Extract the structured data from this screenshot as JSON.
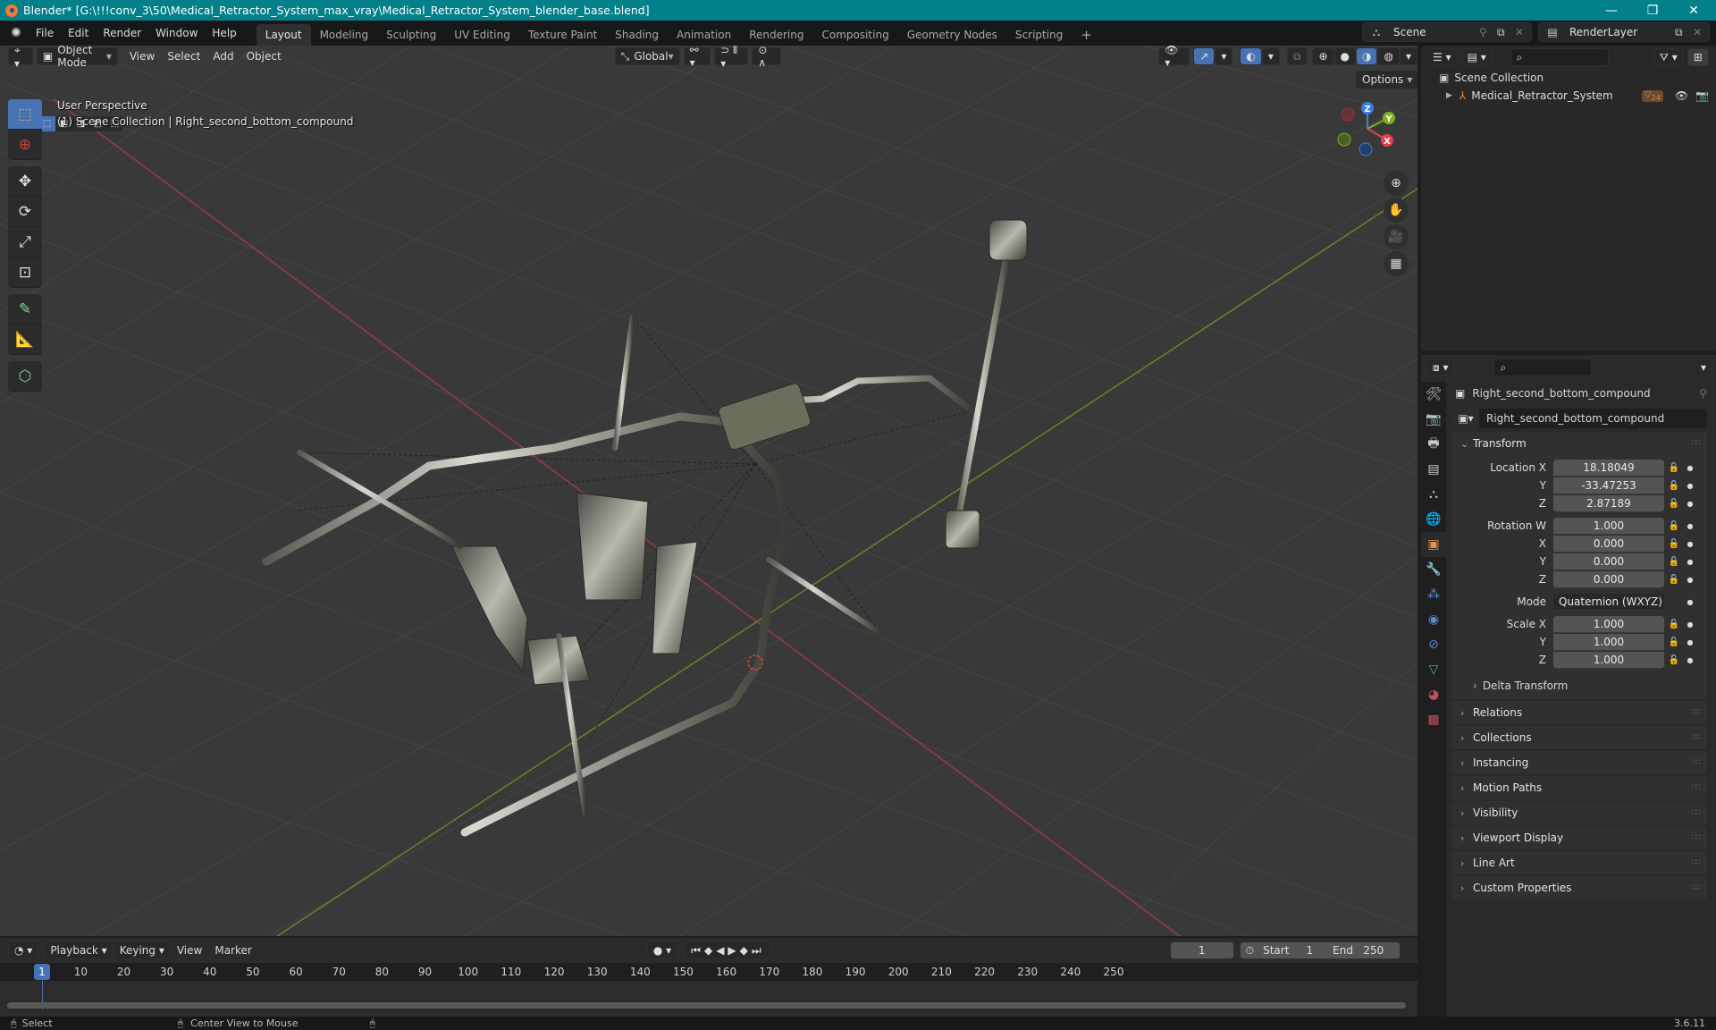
{
  "window": {
    "title": "Blender* [G:\\!!!conv_3\\50\\Medical_Retractor_System_max_vray\\Medical_Retractor_System_blender_base.blend]",
    "minimize": "—",
    "maximize": "❐",
    "close": "✕"
  },
  "menu": [
    "File",
    "Edit",
    "Render",
    "Window",
    "Help"
  ],
  "workspaces": [
    "Layout",
    "Modeling",
    "Sculpting",
    "UV Editing",
    "Texture Paint",
    "Shading",
    "Animation",
    "Rendering",
    "Compositing",
    "Geometry Nodes",
    "Scripting",
    "+"
  ],
  "active_workspace": "Layout",
  "scene": {
    "name": "Scene",
    "view_layer": "RenderLayer"
  },
  "viewport": {
    "mode": "Object Mode",
    "menus": [
      "View",
      "Select",
      "Add",
      "Object"
    ],
    "orientation": "Global",
    "options_label": "Options",
    "info_line1": "User Perspective",
    "info_line2": "(1) Scene Collection | Right_second_bottom_compound",
    "gizmo": {
      "x": "X",
      "y": "Y",
      "z": "Z"
    },
    "colors": {
      "x_axis": "#b8404a",
      "y_axis": "#6a9a2a",
      "x": "#e93c50",
      "y": "#80b020",
      "z": "#3a7ee0"
    }
  },
  "toolbar": {
    "tools": [
      "select-box",
      "cursor",
      "move",
      "rotate",
      "scale",
      "transform",
      "annotate",
      "measure",
      "add-cube"
    ]
  },
  "outliner": {
    "root": "Scene Collection",
    "items": [
      {
        "name": "Medical_Retractor_System",
        "badge": "24"
      }
    ]
  },
  "properties": {
    "object_name": "Right_second_bottom_compound",
    "data_name": "Right_second_bottom_compound",
    "transform_label": "Transform",
    "location": {
      "label": "Location X",
      "x": "18.18049",
      "y": "-33.47253",
      "z": "2.87189"
    },
    "rotation": {
      "label": "Rotation W",
      "w": "1.000",
      "x": "0.000",
      "y": "0.000",
      "z": "0.000"
    },
    "mode_label": "Mode",
    "mode_value": "Quaternion (WXYZ)",
    "scale": {
      "label": "Scale X",
      "x": "1.000",
      "y": "1.000",
      "z": "1.000"
    },
    "axis_labels": {
      "y": "Y",
      "z": "Z",
      "x": "X"
    },
    "delta_transform": "Delta Transform",
    "panels": [
      "Relations",
      "Collections",
      "Instancing",
      "Motion Paths",
      "Visibility",
      "Viewport Display",
      "Line Art",
      "Custom Properties"
    ]
  },
  "timeline": {
    "menus": [
      "Playback",
      "Keying",
      "View",
      "Marker"
    ],
    "current_frame": "1",
    "start_label": "Start",
    "start": "1",
    "end_label": "End",
    "end": "250",
    "ticks": [
      "10",
      "20",
      "30",
      "40",
      "50",
      "60",
      "70",
      "80",
      "90",
      "100",
      "110",
      "120",
      "130",
      "140",
      "150",
      "160",
      "170",
      "180",
      "190",
      "200",
      "210",
      "220",
      "230",
      "240",
      "250"
    ]
  },
  "status": {
    "select": "Select",
    "center_view": "Center View to Mouse",
    "version": "3.6.11"
  }
}
